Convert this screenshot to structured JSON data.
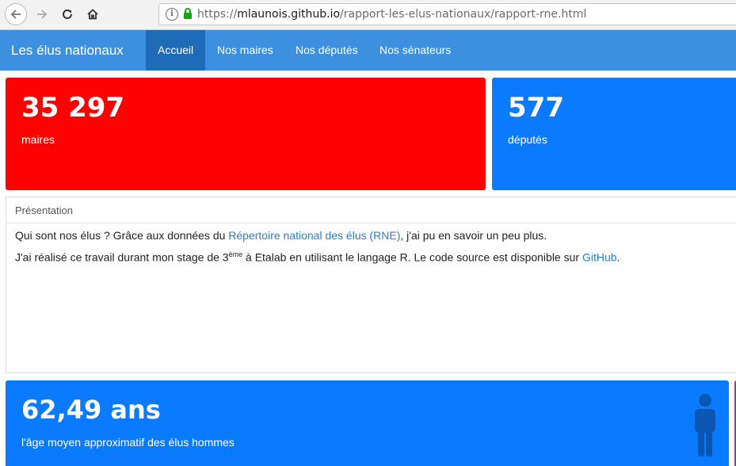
{
  "browser": {
    "url_scheme": "https://",
    "url_host": "mlaunois.github.io",
    "url_path": "/rapport-les-elus-nationaux/rapport-rne.html",
    "icons": [
      "back-arrow-icon",
      "forward-arrow-icon",
      "reload-icon",
      "home-icon",
      "info-icon",
      "lock-icon"
    ]
  },
  "navbar": {
    "brand": "Les élus nationaux",
    "items": [
      {
        "label": "Accueil",
        "active": true
      },
      {
        "label": "Nos maires",
        "active": false
      },
      {
        "label": "Nos députés",
        "active": false
      },
      {
        "label": "Nos sénateurs",
        "active": false
      }
    ]
  },
  "valueboxes": [
    {
      "value": "35 297",
      "caption": "maires",
      "color": "#ff0000"
    },
    {
      "value": "577",
      "caption": "députés",
      "color": "#0a7bff"
    },
    {
      "value": "62,49 ans",
      "caption": "l'âge moyen approximatif des élus hommes",
      "color": "#0a7bff",
      "icon": "male-person-icon"
    }
  ],
  "presentation": {
    "title": "Présentation",
    "p1_before": "Qui sont nos élus ? Grâce aux données du ",
    "p1_link": "Répertoire national des élus (RNE)",
    "p1_after": ", j'ai pu en savoir un peu plus.",
    "p2_before": "J'ai réalisé ce travail durant mon stage de 3",
    "p2_sup": "ème",
    "p2_middle": " à Etalab en utilisant le langage R. Le code source est disponible sur ",
    "p2_link": "GitHub",
    "p2_after": "."
  },
  "colors": {
    "navbar": "#3d8fe0",
    "navbar_active": "#1e6bb8",
    "accent_pink": "#e8177a"
  }
}
